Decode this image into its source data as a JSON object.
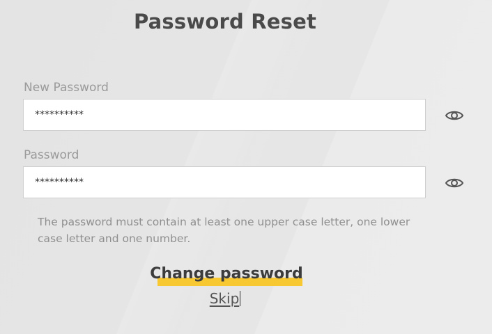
{
  "page": {
    "title": "Password Reset"
  },
  "form": {
    "new_password": {
      "label": "New Password",
      "value": "**********",
      "toggle_icon": "eye-icon"
    },
    "password": {
      "label": "Password",
      "value": "**********",
      "toggle_icon": "eye-icon"
    },
    "hint": "The password must contain at least one upper case letter, one lower case letter and one number.",
    "submit_label": "Change password",
    "skip_label": "Skip"
  },
  "colors": {
    "accent": "#f8c832",
    "text": "#4a4a4a",
    "muted": "#9a9a9a",
    "background": "#e9e9e9"
  }
}
